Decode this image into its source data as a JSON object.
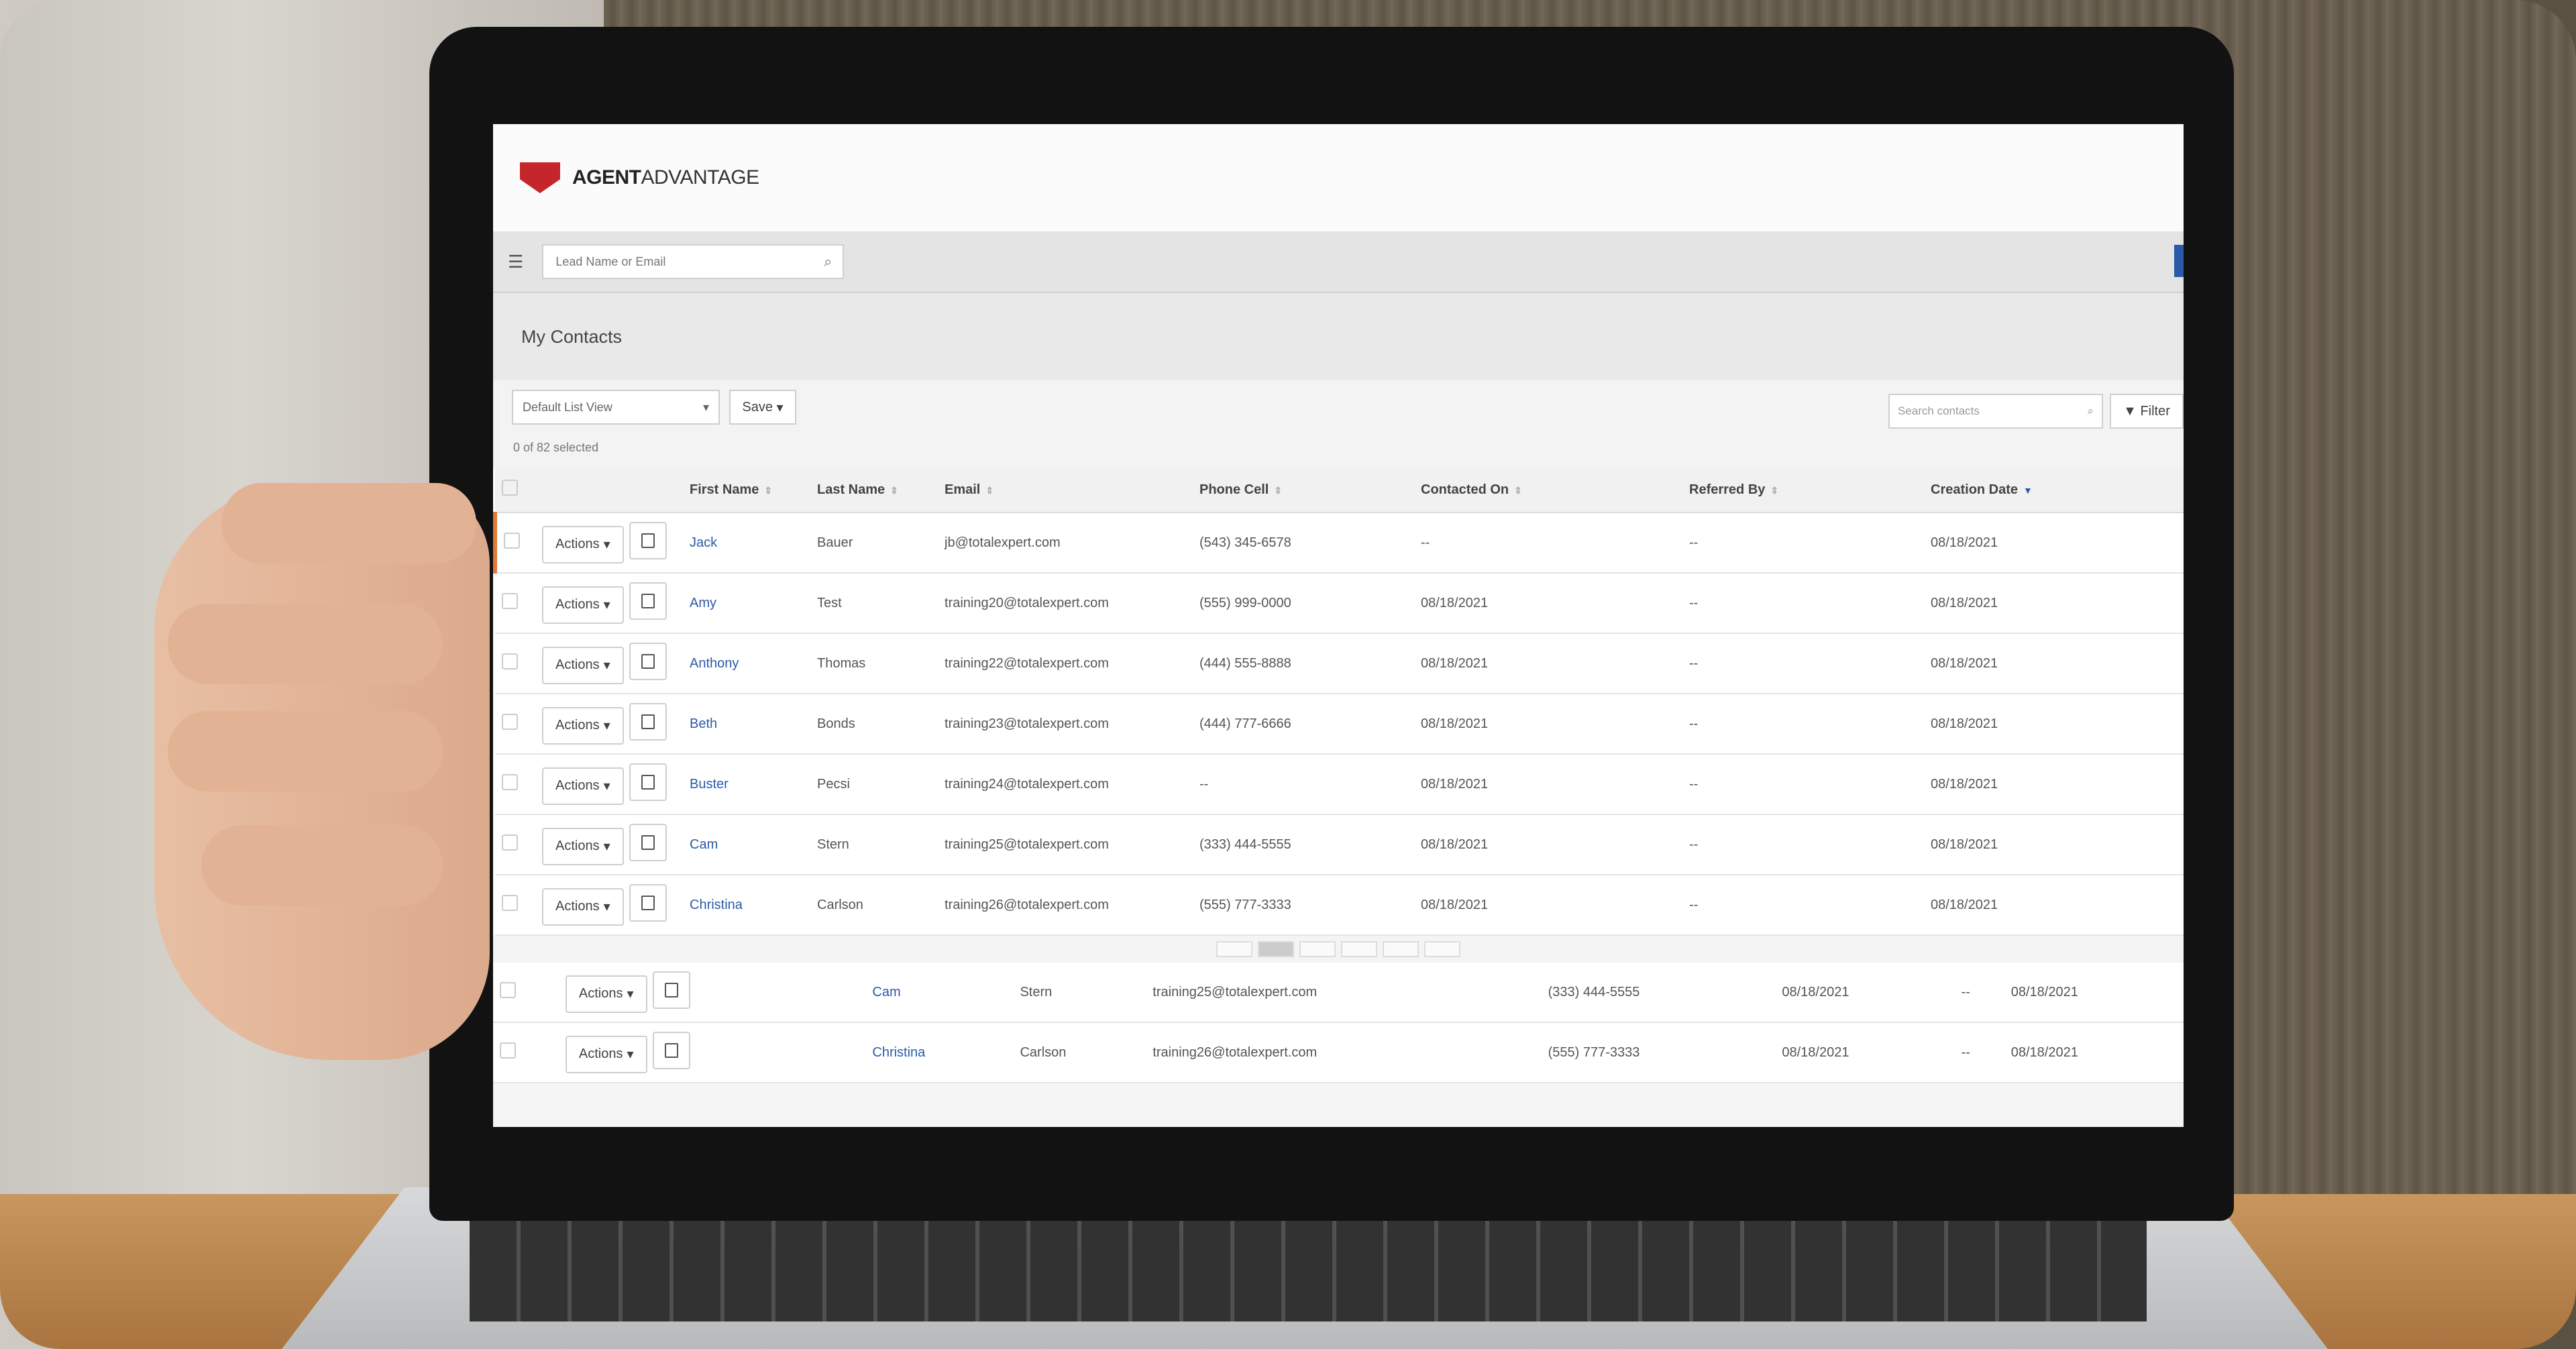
{
  "app": {
    "brand_bold": "AGENT",
    "brand_rest": "ADVANTAGE"
  },
  "topbar": {
    "search_placeholder": "Lead Name or Email"
  },
  "page": {
    "title": "My Contacts"
  },
  "controls": {
    "list_view": "Default List View",
    "save_label": "Save",
    "selected_count": "0 of 82 selected",
    "search_placeholder": "Search contacts",
    "filter_label": "Filter"
  },
  "table": {
    "headers": [
      "First Name",
      "Last Name",
      "Email",
      "Phone Cell",
      "Contacted On",
      "Referred By",
      "Creation Date"
    ],
    "actions_label": "Actions",
    "rows": [
      {
        "first": "Jack",
        "last": "Bauer",
        "email": "jb@totalexpert.com",
        "phone": "(543) 345-6578",
        "contacted": "--",
        "referred": "--",
        "created": "08/18/2021"
      },
      {
        "first": "Amy",
        "last": "Test",
        "email": "training20@totalexpert.com",
        "phone": "(555) 999-0000",
        "contacted": "08/18/2021",
        "referred": "--",
        "created": "08/18/2021"
      },
      {
        "first": "Anthony",
        "last": "Thomas",
        "email": "training22@totalexpert.com",
        "phone": "(444) 555-8888",
        "contacted": "08/18/2021",
        "referred": "--",
        "created": "08/18/2021"
      },
      {
        "first": "Beth",
        "last": "Bonds",
        "email": "training23@totalexpert.com",
        "phone": "(444) 777-6666",
        "contacted": "08/18/2021",
        "referred": "--",
        "created": "08/18/2021"
      },
      {
        "first": "Buster",
        "last": "Pecsi",
        "email": "training24@totalexpert.com",
        "phone": "--",
        "contacted": "08/18/2021",
        "referred": "--",
        "created": "08/18/2021"
      },
      {
        "first": "Cam",
        "last": "Stern",
        "email": "training25@totalexpert.com",
        "phone": "(333) 444-5555",
        "contacted": "08/18/2021",
        "referred": "--",
        "created": "08/18/2021"
      },
      {
        "first": "Christina",
        "last": "Carlson",
        "email": "training26@totalexpert.com",
        "phone": "(555) 777-3333",
        "contacted": "08/18/2021",
        "referred": "--",
        "created": "08/18/2021"
      }
    ],
    "lower_rows": [
      {
        "first": "Cam",
        "last": "Stern",
        "email": "training25@totalexpert.com",
        "phone": "(333) 444-5555",
        "contacted": "08/18/2021",
        "referred": "--",
        "created": "08/18/2021"
      },
      {
        "first": "Christina",
        "last": "Carlson",
        "email": "training26@totalexpert.com",
        "phone": "(555) 777-3333",
        "contacted": "08/18/2021",
        "referred": "--",
        "created": "08/18/2021"
      }
    ]
  },
  "colors": {
    "brand_red": "#c5262b",
    "link_blue": "#2b5aa8"
  }
}
